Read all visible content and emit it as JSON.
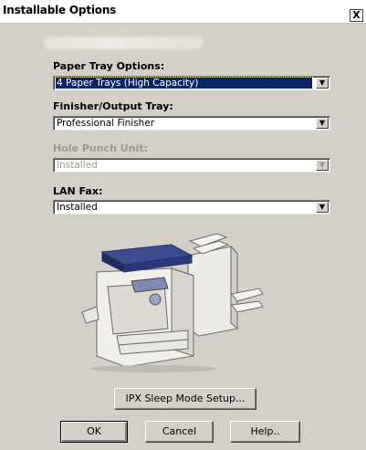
{
  "window": {
    "title": "Installable Options",
    "close_glyph": "X"
  },
  "options": {
    "paper_tray": {
      "label": "Paper Tray Options:",
      "value": "4 Paper Trays (High Capacity)"
    },
    "finisher": {
      "label": "Finisher/Output Tray:",
      "value": "Professional Finisher"
    },
    "hole_punch": {
      "label": "Hole Punch Unit:",
      "value": "Installed"
    },
    "lan_fax": {
      "label": "LAN Fax:",
      "value": "Installed"
    }
  },
  "buttons": {
    "sleep_mode": "IPX Sleep Mode Setup...",
    "ok": "OK",
    "cancel": "Cancel",
    "help": "Help.."
  },
  "icons": {
    "dropdown": "chevron-down-icon",
    "close": "close-icon",
    "printer": "printer-illustration"
  },
  "colors": {
    "dialog_bg": "#d4d0c8",
    "selection_bg": "#0a246a",
    "disabled_text": "#9a9890"
  }
}
